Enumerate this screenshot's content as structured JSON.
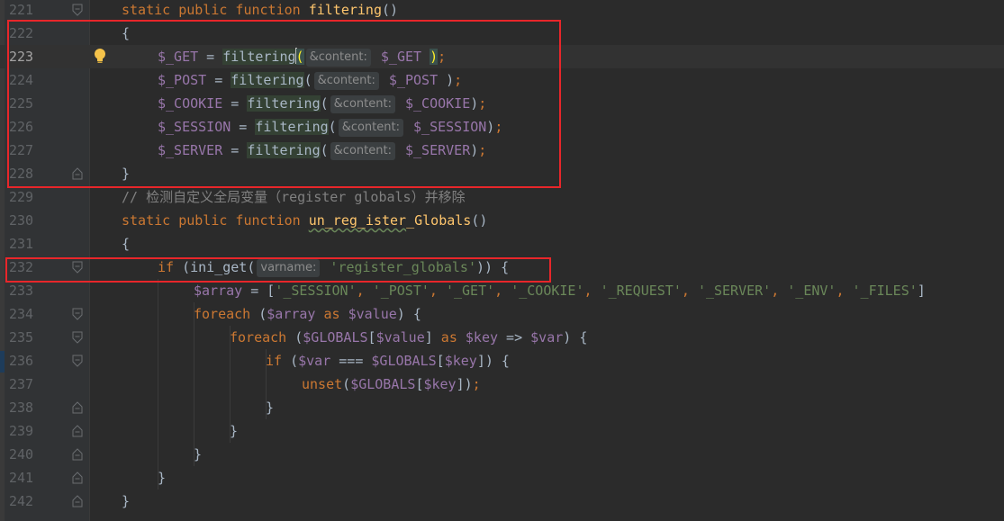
{
  "editor": {
    "lines": [
      {
        "num": "221",
        "tokens": [
          [
            "kw",
            "static public function "
          ],
          [
            "fn",
            "filtering"
          ],
          [
            "pl",
            "()"
          ]
        ],
        "indent": 0,
        "fold": "open"
      },
      {
        "num": "222",
        "tokens": [
          [
            "pl",
            "{"
          ]
        ],
        "indent": 0,
        "fold": ""
      },
      {
        "num": "223",
        "tokens": [
          [
            "var",
            "$_GET"
          ],
          [
            "pl",
            " = "
          ],
          [
            "hl",
            "filtering"
          ],
          [
            "brace",
            "("
          ],
          [
            "hint",
            "&content:"
          ],
          [
            "var",
            " $_GET "
          ],
          [
            "brace",
            ")"
          ],
          [
            "kw",
            ";"
          ]
        ],
        "indent": 1,
        "fold": "",
        "current": true,
        "bulb": true
      },
      {
        "num": "224",
        "tokens": [
          [
            "var",
            "$_POST"
          ],
          [
            "pl",
            " = "
          ],
          [
            "hl",
            "filtering"
          ],
          [
            "pl",
            "("
          ],
          [
            "hint",
            "&content:"
          ],
          [
            "var",
            " $_POST "
          ],
          [
            "pl",
            ")"
          ],
          [
            "kw",
            ";"
          ]
        ],
        "indent": 1,
        "fold": ""
      },
      {
        "num": "225",
        "tokens": [
          [
            "var",
            "$_COOKIE"
          ],
          [
            "pl",
            " = "
          ],
          [
            "hl",
            "filtering"
          ],
          [
            "pl",
            "("
          ],
          [
            "hint",
            "&content:"
          ],
          [
            "var",
            " $_COOKIE"
          ],
          [
            "pl",
            ")"
          ],
          [
            "kw",
            ";"
          ]
        ],
        "indent": 1,
        "fold": ""
      },
      {
        "num": "226",
        "tokens": [
          [
            "var",
            "$_SESSION"
          ],
          [
            "pl",
            " = "
          ],
          [
            "hl",
            "filtering"
          ],
          [
            "pl",
            "("
          ],
          [
            "hint",
            "&content:"
          ],
          [
            "var",
            " $_SESSION"
          ],
          [
            "pl",
            ")"
          ],
          [
            "kw",
            ";"
          ]
        ],
        "indent": 1,
        "fold": ""
      },
      {
        "num": "227",
        "tokens": [
          [
            "var",
            "$_SERVER"
          ],
          [
            "pl",
            " = "
          ],
          [
            "hl",
            "filtering"
          ],
          [
            "pl",
            "("
          ],
          [
            "hint",
            "&content:"
          ],
          [
            "var",
            " $_SERVER"
          ],
          [
            "pl",
            ")"
          ],
          [
            "kw",
            ";"
          ]
        ],
        "indent": 1,
        "fold": ""
      },
      {
        "num": "228",
        "tokens": [
          [
            "pl",
            "}"
          ]
        ],
        "indent": 0,
        "fold": "close"
      },
      {
        "num": "229",
        "tokens": [
          [
            "cm",
            "// 检测自定义全局变量（register globals）并移除"
          ]
        ],
        "indent": 0,
        "fold": ""
      },
      {
        "num": "230",
        "tokens": [
          [
            "kw",
            "static public function "
          ],
          [
            "fnw",
            "un_reg_ister"
          ],
          [
            "fn",
            "_Globals"
          ],
          [
            "pl",
            "()"
          ]
        ],
        "indent": 0,
        "fold": ""
      },
      {
        "num": "231",
        "tokens": [
          [
            "pl",
            "{"
          ]
        ],
        "indent": 0,
        "fold": ""
      },
      {
        "num": "232",
        "tokens": [
          [
            "kw",
            "if "
          ],
          [
            "pl",
            "(ini_get("
          ],
          [
            "hint",
            "varname:"
          ],
          [
            "str",
            " 'register_globals'"
          ],
          [
            "pl",
            ")) {"
          ]
        ],
        "indent": 1,
        "fold": "open"
      },
      {
        "num": "233",
        "tokens": [
          [
            "var",
            "$array"
          ],
          [
            "pl",
            " = ["
          ],
          [
            "str",
            "'_SESSION'"
          ],
          [
            "kw",
            ", "
          ],
          [
            "str",
            "'_POST'"
          ],
          [
            "kw",
            ", "
          ],
          [
            "str",
            "'_GET'"
          ],
          [
            "kw",
            ", "
          ],
          [
            "str",
            "'_COOKIE'"
          ],
          [
            "kw",
            ", "
          ],
          [
            "str",
            "'_REQUEST'"
          ],
          [
            "kw",
            ", "
          ],
          [
            "str",
            "'_SERVER'"
          ],
          [
            "kw",
            ", "
          ],
          [
            "str",
            "'_ENV'"
          ],
          [
            "kw",
            ", "
          ],
          [
            "str",
            "'_FILES'"
          ],
          [
            "pl",
            "]"
          ]
        ],
        "indent": 2,
        "fold": ""
      },
      {
        "num": "234",
        "tokens": [
          [
            "kw",
            "foreach "
          ],
          [
            "pl",
            "("
          ],
          [
            "var",
            "$array"
          ],
          [
            "kw",
            " as "
          ],
          [
            "var",
            "$value"
          ],
          [
            "pl",
            ") {"
          ]
        ],
        "indent": 2,
        "fold": "open"
      },
      {
        "num": "235",
        "tokens": [
          [
            "kw",
            "foreach "
          ],
          [
            "pl",
            "("
          ],
          [
            "var",
            "$GLOBALS"
          ],
          [
            "pl",
            "["
          ],
          [
            "var",
            "$value"
          ],
          [
            "pl",
            "]"
          ],
          [
            "kw",
            " as "
          ],
          [
            "var",
            "$key"
          ],
          [
            "pl",
            " => "
          ],
          [
            "var",
            "$var"
          ],
          [
            "pl",
            ") {"
          ]
        ],
        "indent": 3,
        "fold": "open"
      },
      {
        "num": "236",
        "tokens": [
          [
            "kw",
            "if "
          ],
          [
            "pl",
            "("
          ],
          [
            "var",
            "$var"
          ],
          [
            "pl",
            " === "
          ],
          [
            "var",
            "$GLOBALS"
          ],
          [
            "pl",
            "["
          ],
          [
            "var",
            "$key"
          ],
          [
            "pl",
            "]) {"
          ]
        ],
        "indent": 4,
        "fold": "open"
      },
      {
        "num": "237",
        "tokens": [
          [
            "kw",
            "unset"
          ],
          [
            "pl",
            "("
          ],
          [
            "var",
            "$GLOBALS"
          ],
          [
            "pl",
            "["
          ],
          [
            "var",
            "$key"
          ],
          [
            "pl",
            "])"
          ],
          [
            "kw",
            ";"
          ]
        ],
        "indent": 5,
        "fold": ""
      },
      {
        "num": "238",
        "tokens": [
          [
            "pl",
            "}"
          ]
        ],
        "indent": 4,
        "fold": "close"
      },
      {
        "num": "239",
        "tokens": [
          [
            "pl",
            "}"
          ]
        ],
        "indent": 3,
        "fold": "close"
      },
      {
        "num": "240",
        "tokens": [
          [
            "pl",
            "}"
          ]
        ],
        "indent": 2,
        "fold": "close"
      },
      {
        "num": "241",
        "tokens": [
          [
            "pl",
            "}"
          ]
        ],
        "indent": 1,
        "fold": "close"
      },
      {
        "num": "242",
        "tokens": [
          [
            "pl",
            "}"
          ]
        ],
        "indent": 0,
        "fold": "close"
      }
    ]
  },
  "annotations": {
    "box_color": "#e8262a"
  },
  "colors": {
    "background": "#2b2b2b",
    "keyword": "#cc7832",
    "function": "#ffc66d",
    "variable": "#9876aa",
    "string": "#6a8759",
    "comment": "#808080"
  },
  "icons": {
    "bulb": "lightbulb-icon",
    "fold_open": "fold-open-icon",
    "fold_close": "fold-close-icon"
  }
}
